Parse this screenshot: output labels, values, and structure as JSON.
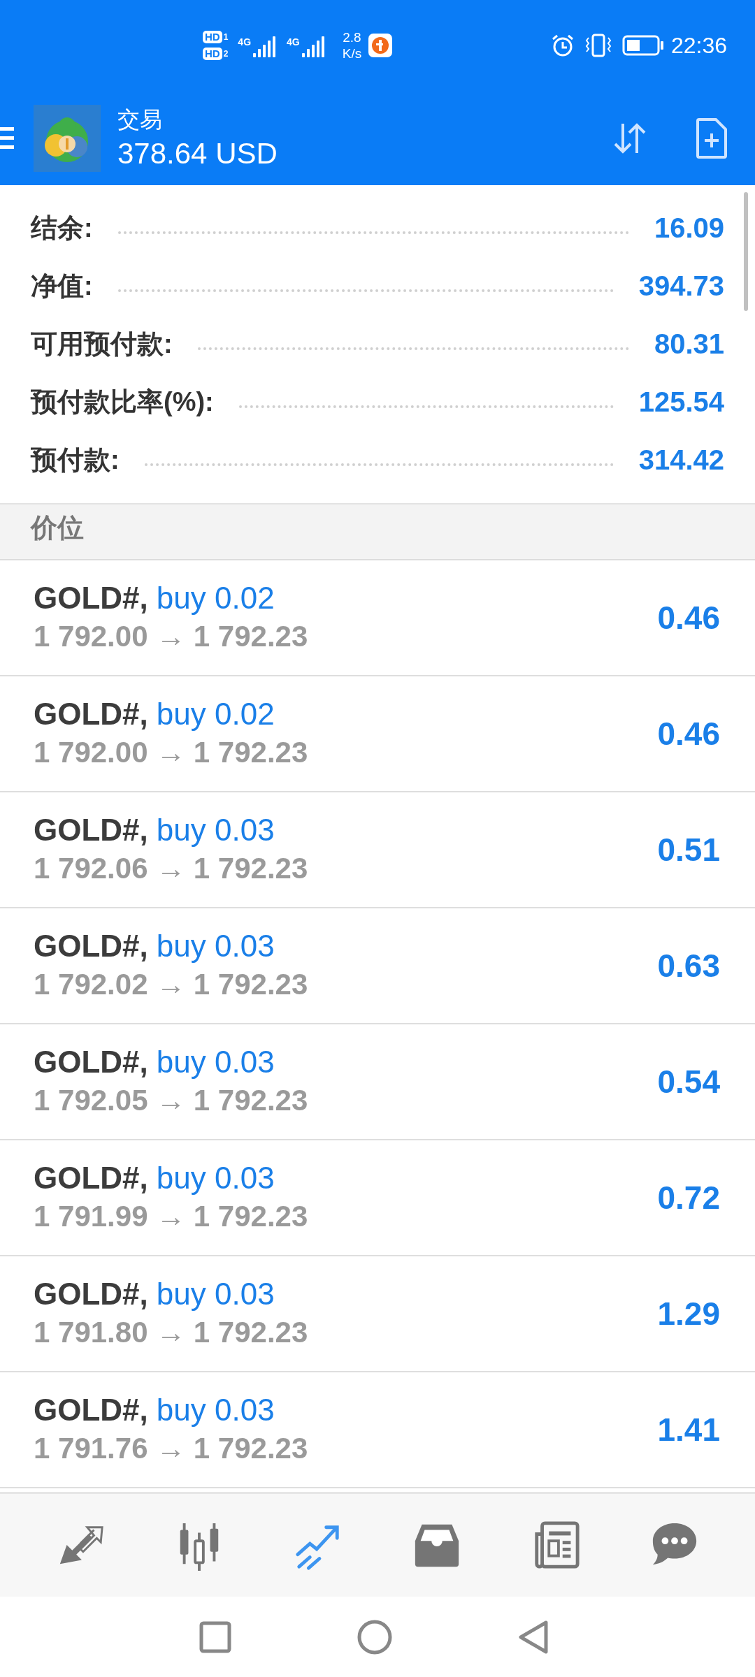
{
  "status_bar": {
    "hd_badges": [
      {
        "text": "HD",
        "sim": "1"
      },
      {
        "text": "HD",
        "sim": "2"
      }
    ],
    "networks": [
      {
        "label": "4G"
      },
      {
        "label": "4G"
      }
    ],
    "speed": {
      "value": "2.8",
      "unit": "K/s"
    },
    "time": "22:36"
  },
  "header": {
    "title": "交易",
    "balance": "378.64 USD"
  },
  "summary": [
    {
      "label": "结余:",
      "value": "16.09"
    },
    {
      "label": "净值:",
      "value": "394.73"
    },
    {
      "label": "可用预付款:",
      "value": "80.31"
    },
    {
      "label": "预付款比率(%):",
      "value": "125.54"
    },
    {
      "label": "预付款:",
      "value": "314.42"
    }
  ],
  "section_title": "价位",
  "positions": [
    {
      "symbol": "GOLD#,",
      "order": "buy 0.02",
      "prices": "1 792.00 → 1 792.23",
      "profit": "0.46"
    },
    {
      "symbol": "GOLD#,",
      "order": "buy 0.02",
      "prices": "1 792.00 → 1 792.23",
      "profit": "0.46"
    },
    {
      "symbol": "GOLD#,",
      "order": "buy 0.03",
      "prices": "1 792.06 → 1 792.23",
      "profit": "0.51"
    },
    {
      "symbol": "GOLD#,",
      "order": "buy 0.03",
      "prices": "1 792.02 → 1 792.23",
      "profit": "0.63"
    },
    {
      "symbol": "GOLD#,",
      "order": "buy 0.03",
      "prices": "1 792.05 → 1 792.23",
      "profit": "0.54"
    },
    {
      "symbol": "GOLD#,",
      "order": "buy 0.03",
      "prices": "1 791.99 → 1 792.23",
      "profit": "0.72"
    },
    {
      "symbol": "GOLD#,",
      "order": "buy 0.03",
      "prices": "1 791.80 → 1 792.23",
      "profit": "1.29"
    },
    {
      "symbol": "GOLD#,",
      "order": "buy 0.03",
      "prices": "1 791.76 → 1 792.23",
      "profit": "1.41"
    }
  ],
  "bottom_nav": [
    {
      "kind": "quotes",
      "selected": false
    },
    {
      "kind": "chart",
      "selected": false
    },
    {
      "kind": "trade",
      "selected": true
    },
    {
      "kind": "history",
      "selected": false
    },
    {
      "kind": "news",
      "selected": false
    },
    {
      "kind": "messages",
      "selected": false
    }
  ]
}
